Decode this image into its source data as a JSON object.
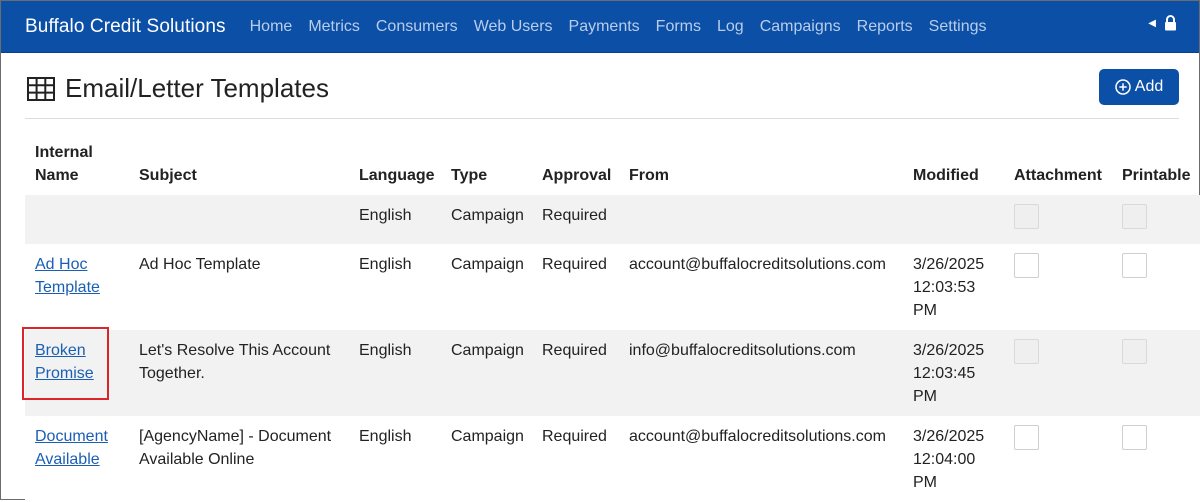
{
  "app": {
    "brand": "Buffalo Credit Solutions"
  },
  "nav": {
    "items": [
      "Home",
      "Metrics",
      "Consumers",
      "Web Users",
      "Payments",
      "Forms",
      "Log",
      "Campaigns",
      "Reports",
      "Settings"
    ]
  },
  "nav_icons": {
    "collapse": "caret-left-icon",
    "lock": "lock-icon"
  },
  "page": {
    "title": "Email/Letter Templates",
    "title_icon": "grid-table-icon",
    "add_label": "Add",
    "add_icon": "plus-circle-icon"
  },
  "table": {
    "headers": {
      "internal_name_line1": "Internal",
      "internal_name_line2": "Name",
      "subject": "Subject",
      "language": "Language",
      "type": "Type",
      "approval": "Approval",
      "from": "From",
      "modified": "Modified",
      "attachment": "Attachment",
      "printable": "Printable"
    },
    "rows": [
      {
        "name_line1": "",
        "name_line2": "",
        "subject_line1": "",
        "subject_line2": "",
        "language": "English",
        "type": "Campaign",
        "approval": "Required",
        "from": "",
        "modified_line1": "",
        "modified_line2": "",
        "modified_line3": ""
      },
      {
        "name_line1": "Ad Hoc",
        "name_line2": "Template",
        "subject_line1": "Ad Hoc Template",
        "subject_line2": "",
        "language": "English",
        "type": "Campaign",
        "approval": "Required",
        "from": "account@buffalocreditsolutions.com",
        "modified_line1": "3/26/2025",
        "modified_line2": "12:03:53",
        "modified_line3": "PM"
      },
      {
        "name_line1": "Broken",
        "name_line2": "Promise",
        "subject_line1": "Let's Resolve This Account",
        "subject_line2": "Together.",
        "language": "English",
        "type": "Campaign",
        "approval": "Required",
        "from": "info@buffalocreditsolutions.com",
        "modified_line1": "3/26/2025",
        "modified_line2": "12:03:45",
        "modified_line3": "PM"
      },
      {
        "name_line1": "Document",
        "name_line2": "Available",
        "subject_line1": "[AgencyName] - Document",
        "subject_line2": "Available Online",
        "language": "English",
        "type": "Campaign",
        "approval": "Required",
        "from": "account@buffalocreditsolutions.com",
        "modified_line1": "3/26/2025",
        "modified_line2": "12:04:00",
        "modified_line3": "PM"
      }
    ]
  },
  "colors": {
    "navbar": "#0b4fa6",
    "link": "#1a5fb4",
    "highlight": "#d9262b"
  }
}
